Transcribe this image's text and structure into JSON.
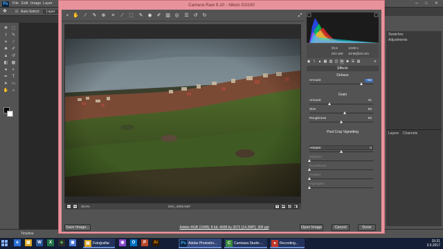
{
  "photoshop": {
    "menu": [
      "File",
      "Edit",
      "Image",
      "Layer"
    ],
    "options": {
      "auto_select": "Auto-Select:",
      "layer_select": "Layer"
    },
    "right_dock": {
      "swatches_tab": "Swatches",
      "adjustments_tab": "Adjustments"
    },
    "layers_panel": {
      "layers_tab": "Layers",
      "channels_tab": "Channels"
    },
    "timeline_label": "Timeline"
  },
  "camera_raw": {
    "window_title": "Camera Raw 9.10 - Nikon D3100",
    "zoom": "38.5%",
    "filename": "DSC_0005.NEF",
    "camera_info": {
      "aperture": "f/3.5",
      "shutter": "1/100 s",
      "iso": "ISO 200",
      "lens": "18-55@22 mm"
    },
    "panel_title": "Effects",
    "sections": {
      "dehaze": "Dehaze",
      "grain": "Grain",
      "vignetting": "Post Crop Vignetting"
    },
    "sliders": {
      "dehaze_amount": {
        "label": "Amount",
        "value": "+62",
        "fraction": 0.81
      },
      "grain_amount": {
        "label": "Amount",
        "value": "31",
        "fraction": 0.31
      },
      "grain_size": {
        "label": "Size",
        "value": "55",
        "fraction": 0.55
      },
      "grain_roughness": {
        "label": "Roughness",
        "value": "50",
        "fraction": 0.5
      },
      "vignette_amount": {
        "label": "Amount",
        "value": "0",
        "fraction": 0.5
      },
      "vignette_midpoint": {
        "label": "Midpoint",
        "value": "",
        "fraction": 0.0
      },
      "vignette_roundness": {
        "label": "Roundness",
        "value": "",
        "fraction": 0.0
      },
      "vignette_feather": {
        "label": "Feather",
        "value": "",
        "fraction": 0.0
      },
      "vignette_highlights": {
        "label": "Highlights",
        "value": "",
        "fraction": 0.0
      }
    },
    "style_label": "Style:",
    "workflow_link": "Adobe RGB (1998); 8 bit; 4608 by 3072 (14.2MP); 300 ppi",
    "buttons": {
      "save": "Save Image...",
      "open": "Open Image",
      "cancel": "Cancel",
      "done": "Done"
    }
  },
  "taskbar": {
    "items": {
      "folder": "Fotoğraflar",
      "photoshop": "Adobe Photosho...",
      "camtasia": "Camtasia Studio ...",
      "recording": "Recording..."
    },
    "time": "15:31",
    "date": "3.5.2017"
  },
  "colors": {
    "dialog_border": "#e8939c",
    "panel_bg": "#535353",
    "highlight": "#3d6db5"
  }
}
